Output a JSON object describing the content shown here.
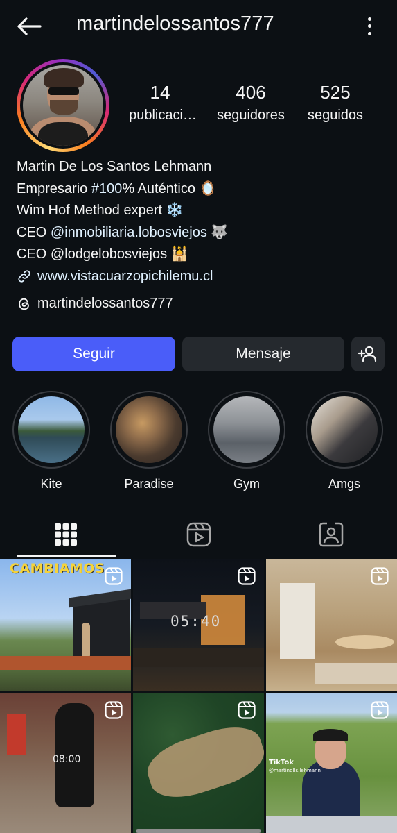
{
  "header": {
    "username": "martindelossantos777",
    "back_icon": "arrow-left-icon",
    "more_icon": "more-vertical-icon"
  },
  "stats": [
    {
      "value": "14",
      "label": "publicaci…"
    },
    {
      "value": "406",
      "label": "seguidores"
    },
    {
      "value": "525",
      "label": "seguidos"
    }
  ],
  "bio": {
    "name": "Martin De Los Santos Lehmann",
    "line1_pre": "Empresario ",
    "line1_tag": "#100",
    "line1_post": "% Auténtico 🪞",
    "line2": "Wim Hof Method expert ❄️",
    "line3_pre": "CEO ",
    "line3_mention": "@inmobiliaria.lobosviejos",
    "line3_post": " 🐺",
    "line4": "CEO @lodgelobosviejos 🕌",
    "link": "www.vistacuarzopichilemu.cl",
    "threads": "martindelossantos777"
  },
  "actions": {
    "follow": "Seguir",
    "message": "Mensaje",
    "add_user_icon": "add-user-icon"
  },
  "highlights": [
    {
      "label": "Kite"
    },
    {
      "label": "Paradise"
    },
    {
      "label": "Gym"
    },
    {
      "label": "Amgs"
    }
  ],
  "tabs": [
    {
      "icon": "grid-icon",
      "active": true
    },
    {
      "icon": "reels-icon",
      "active": false
    },
    {
      "icon": "tagged-icon",
      "active": false
    }
  ],
  "posts": {
    "tile1_overlay": "CAMBIAMOS",
    "tile2_overlay": "05:40",
    "tile4_overlay": "08:00",
    "tile6_watermark": "TikTok",
    "tile6_handle": "@martindlls.lehmann"
  },
  "colors": {
    "background": "#0c1014",
    "follow_button": "#4a5df9",
    "secondary_button": "#25292e",
    "link": "#e0f1ff"
  }
}
